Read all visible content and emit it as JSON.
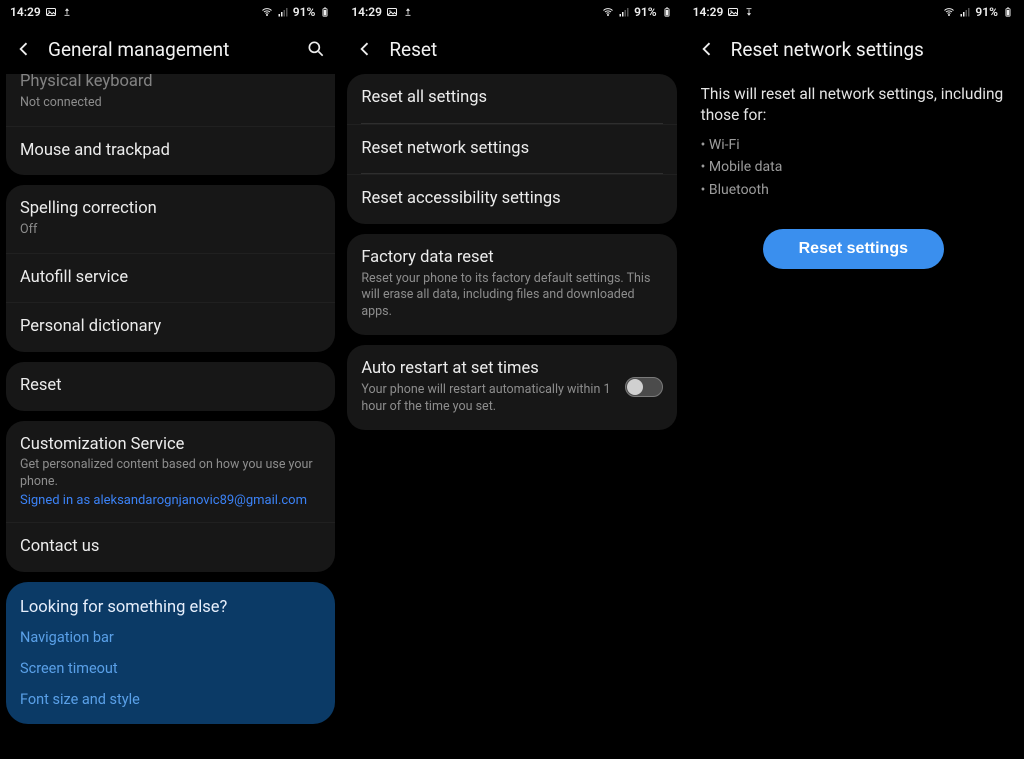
{
  "status": {
    "time": "14:29",
    "battery": "91%"
  },
  "screen1": {
    "title": "General management",
    "partial_keyboard_title": "Physical keyboard",
    "partial_keyboard_sub": "Not connected",
    "mouse": "Mouse and trackpad",
    "spelling_title": "Spelling correction",
    "spelling_sub": "Off",
    "autofill": "Autofill service",
    "dictionary": "Personal dictionary",
    "reset": "Reset",
    "customization_title": "Customization Service",
    "customization_sub": "Get personalized content based on how you use your phone.",
    "customization_signedin": "Signed in as aleksandarognjanovic89@gmail.com",
    "contact": "Contact us",
    "tip_title": "Looking for something else?",
    "tip_links": [
      "Navigation bar",
      "Screen timeout",
      "Font size and style"
    ]
  },
  "screen2": {
    "title": "Reset",
    "reset_all": "Reset all settings",
    "reset_network": "Reset network settings",
    "reset_accessibility": "Reset accessibility settings",
    "factory_title": "Factory data reset",
    "factory_sub": "Reset your phone to its factory default settings. This will erase all data, including files and downloaded apps.",
    "auto_title": "Auto restart at set times",
    "auto_sub": "Your phone will restart automatically within 1 hour of the time you set."
  },
  "screen3": {
    "title": "Reset network settings",
    "body": "This will reset all network settings, including those for:",
    "bullets": [
      "Wi-Fi",
      "Mobile data",
      "Bluetooth"
    ],
    "button": "Reset settings"
  }
}
